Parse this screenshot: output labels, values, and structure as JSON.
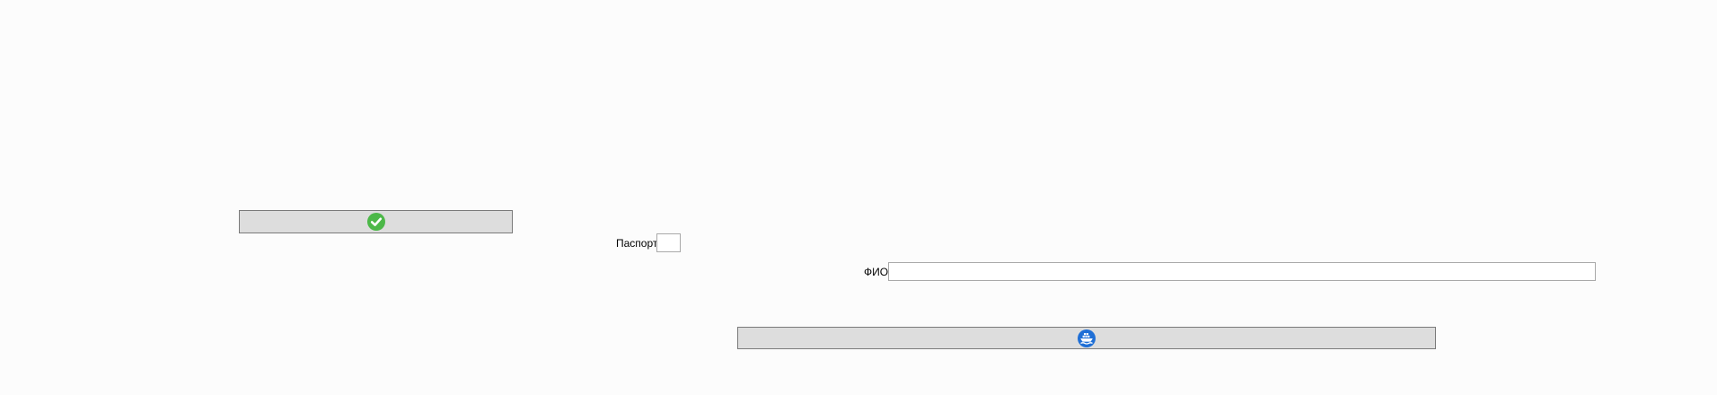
{
  "form": {
    "confirm_button": {
      "icon": "check-circle-icon",
      "icon_color": "#4cb848"
    },
    "passport": {
      "label": "Паспорт",
      "value": "",
      "placeholder": ""
    },
    "fio": {
      "label": "ФИО",
      "value": "",
      "placeholder": ""
    },
    "ship_button": {
      "icon": "ship-icon",
      "icon_color": "#1f6fd6"
    }
  },
  "colors": {
    "background": "#fcfcfc",
    "button_face": "#dddddd",
    "button_border": "#7a7a7a",
    "field_border": "#a9a9a9"
  }
}
